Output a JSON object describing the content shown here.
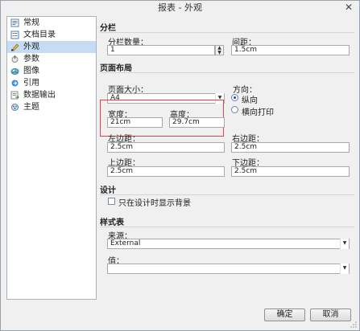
{
  "window": {
    "title": "报表 - 外观",
    "close_glyph": "✕"
  },
  "tree": {
    "items": [
      {
        "label": "常规",
        "icon": "general-icon"
      },
      {
        "label": "文档目录",
        "icon": "toc-icon"
      },
      {
        "label": "外观",
        "icon": "appearance-icon",
        "selected": true
      },
      {
        "label": "参数",
        "icon": "parameters-icon"
      },
      {
        "label": "图像",
        "icon": "image-icon"
      },
      {
        "label": "引用",
        "icon": "reference-icon"
      },
      {
        "label": "数据输出",
        "icon": "data-output-icon"
      },
      {
        "label": "主题",
        "icon": "theme-icon"
      }
    ]
  },
  "columns": {
    "title": "分栏",
    "count_label": "分栏数量：",
    "count_value": "1",
    "spacing_label": "间距：",
    "spacing_value": "1.5cm"
  },
  "layout": {
    "title": "页面布局",
    "page_size_label": "页面大小：",
    "page_size_value": "A4",
    "orientation_label": "方向：",
    "portrait_label": "纵向",
    "landscape_label": "横向打印",
    "width_label": "宽度：",
    "width_value": "21cm",
    "height_label": "高度：",
    "height_value": "29.7cm",
    "left_margin_label": "左边距：",
    "left_margin_value": "2.5cm",
    "right_margin_label": "右边距：",
    "right_margin_value": "2.5cm",
    "top_margin_label": "上边距：",
    "top_margin_value": "2.5cm",
    "bottom_margin_label": "下边距：",
    "bottom_margin_value": "2.5cm"
  },
  "design": {
    "title": "设计",
    "bg_checkbox_label": "只在设计时显示背景",
    "bg_checked": false
  },
  "stylesheet": {
    "title": "样式表",
    "source_label": "来源：",
    "source_value": "External",
    "value_label": "值：",
    "value_value": ""
  },
  "buttons": {
    "ok": "确定",
    "cancel": "取消"
  },
  "colors": {
    "selection": "#c6dcf4",
    "highlight_box": "#e0434a"
  }
}
